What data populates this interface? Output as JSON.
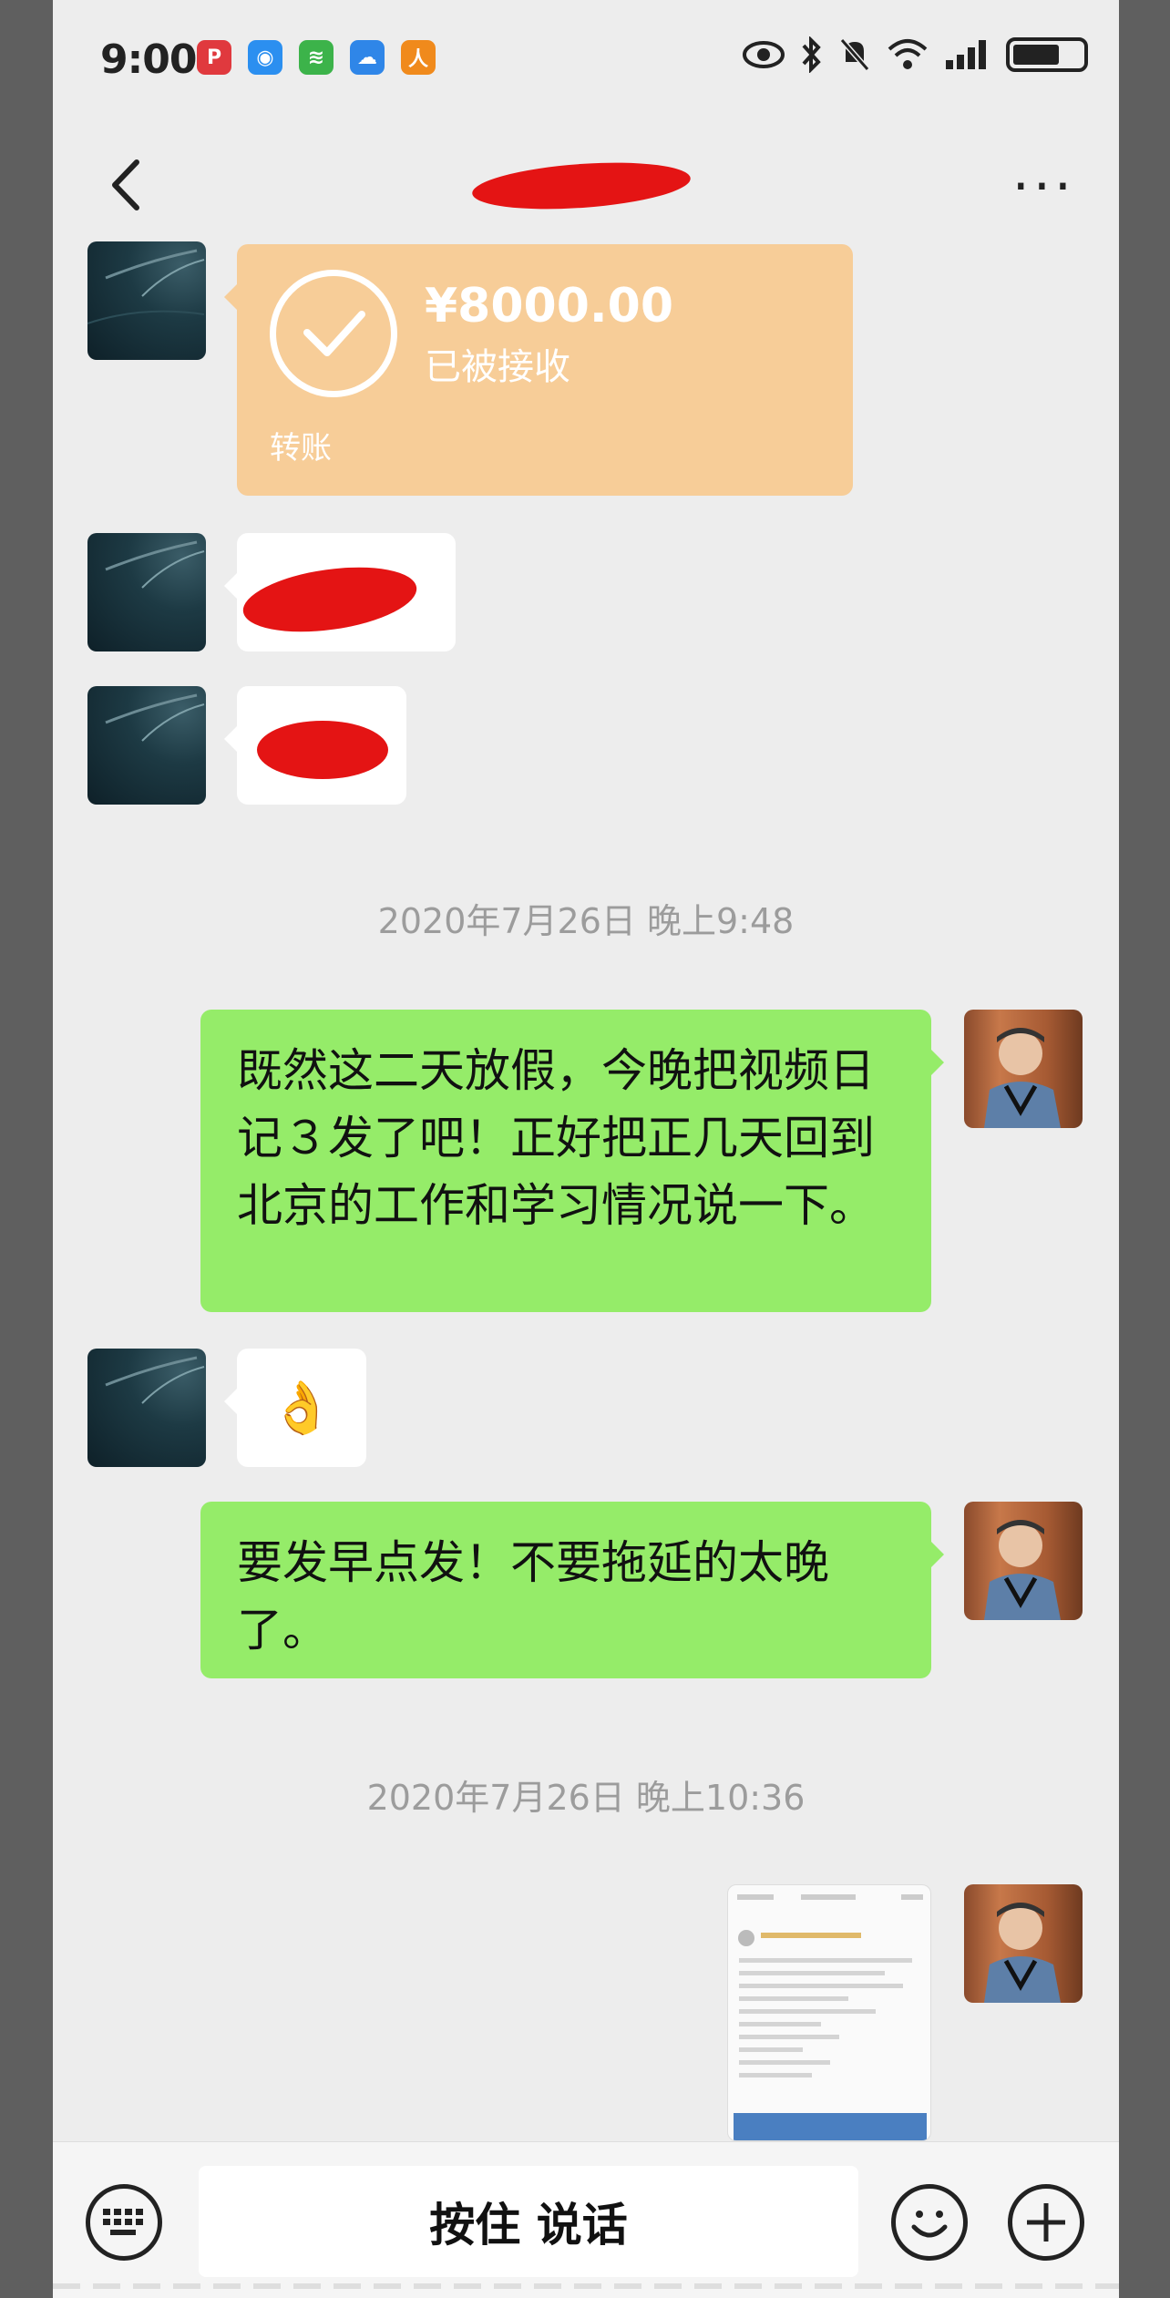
{
  "status_bar": {
    "time": "9:00"
  },
  "header": {
    "title": ""
  },
  "transfer": {
    "amount": "¥8000.00",
    "status": "已被接收",
    "label": "转账"
  },
  "timestamps": [
    "2020年7月26日 晚上9:48",
    "2020年7月26日 晚上10:36"
  ],
  "messages": {
    "sent_1": "既然这二天放假，今晚把视频日记３发了吧！正好把正几天回到北京的工作和学习情况说一下。",
    "received_emoji": "👌",
    "sent_2": "要发早点发！不要拖延的太晚了。"
  },
  "input_bar": {
    "hold_to_talk": "按住 说话"
  },
  "colors": {
    "bubble_green": "#95ec69",
    "transfer_orange": "#f7cd98",
    "background": "#ededed",
    "redaction": "#e41414"
  }
}
